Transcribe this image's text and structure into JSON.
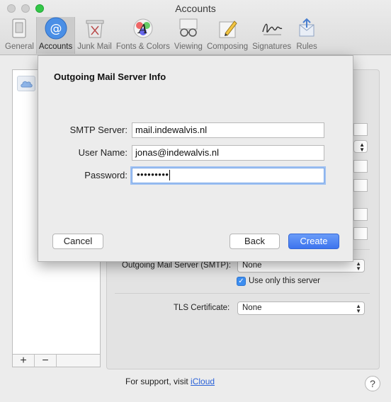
{
  "window": {
    "title": "Accounts"
  },
  "toolbar": {
    "tabs": [
      {
        "label": "General",
        "icon": "general-icon"
      },
      {
        "label": "Accounts",
        "icon": "at-sign-icon",
        "active": true
      },
      {
        "label": "Junk Mail",
        "icon": "junk-mail-icon"
      },
      {
        "label": "Fonts & Colors",
        "icon": "fonts-colors-icon"
      },
      {
        "label": "Viewing",
        "icon": "glasses-icon"
      },
      {
        "label": "Composing",
        "icon": "pencil-icon"
      },
      {
        "label": "Signatures",
        "icon": "signature-icon"
      },
      {
        "label": "Rules",
        "icon": "rules-icon"
      }
    ]
  },
  "sidebar": {
    "add_label": "+",
    "remove_label": "−"
  },
  "background": {
    "smtp_label": "Outgoing Mail Server (SMTP):",
    "smtp_value": "None",
    "use_only_label": "Use only this server",
    "use_only_checked": true,
    "tls_label": "TLS Certificate:",
    "tls_value": "None"
  },
  "footer": {
    "support_text": "For support, visit ",
    "support_link": "iCloud",
    "help_label": "?"
  },
  "sheet": {
    "title": "Outgoing Mail Server Info",
    "smtp_server_label": "SMTP Server:",
    "smtp_server_value": "mail.indewalvis.nl",
    "user_name_label": "User Name:",
    "user_name_value": "jonas@indewalvis.nl",
    "password_label": "Password:",
    "password_value": "•••••••••",
    "cancel_label": "Cancel",
    "back_label": "Back",
    "create_label": "Create"
  },
  "colors": {
    "accent": "#3d74ee",
    "zoom_button": "#33c748",
    "link": "#2a62d8"
  }
}
